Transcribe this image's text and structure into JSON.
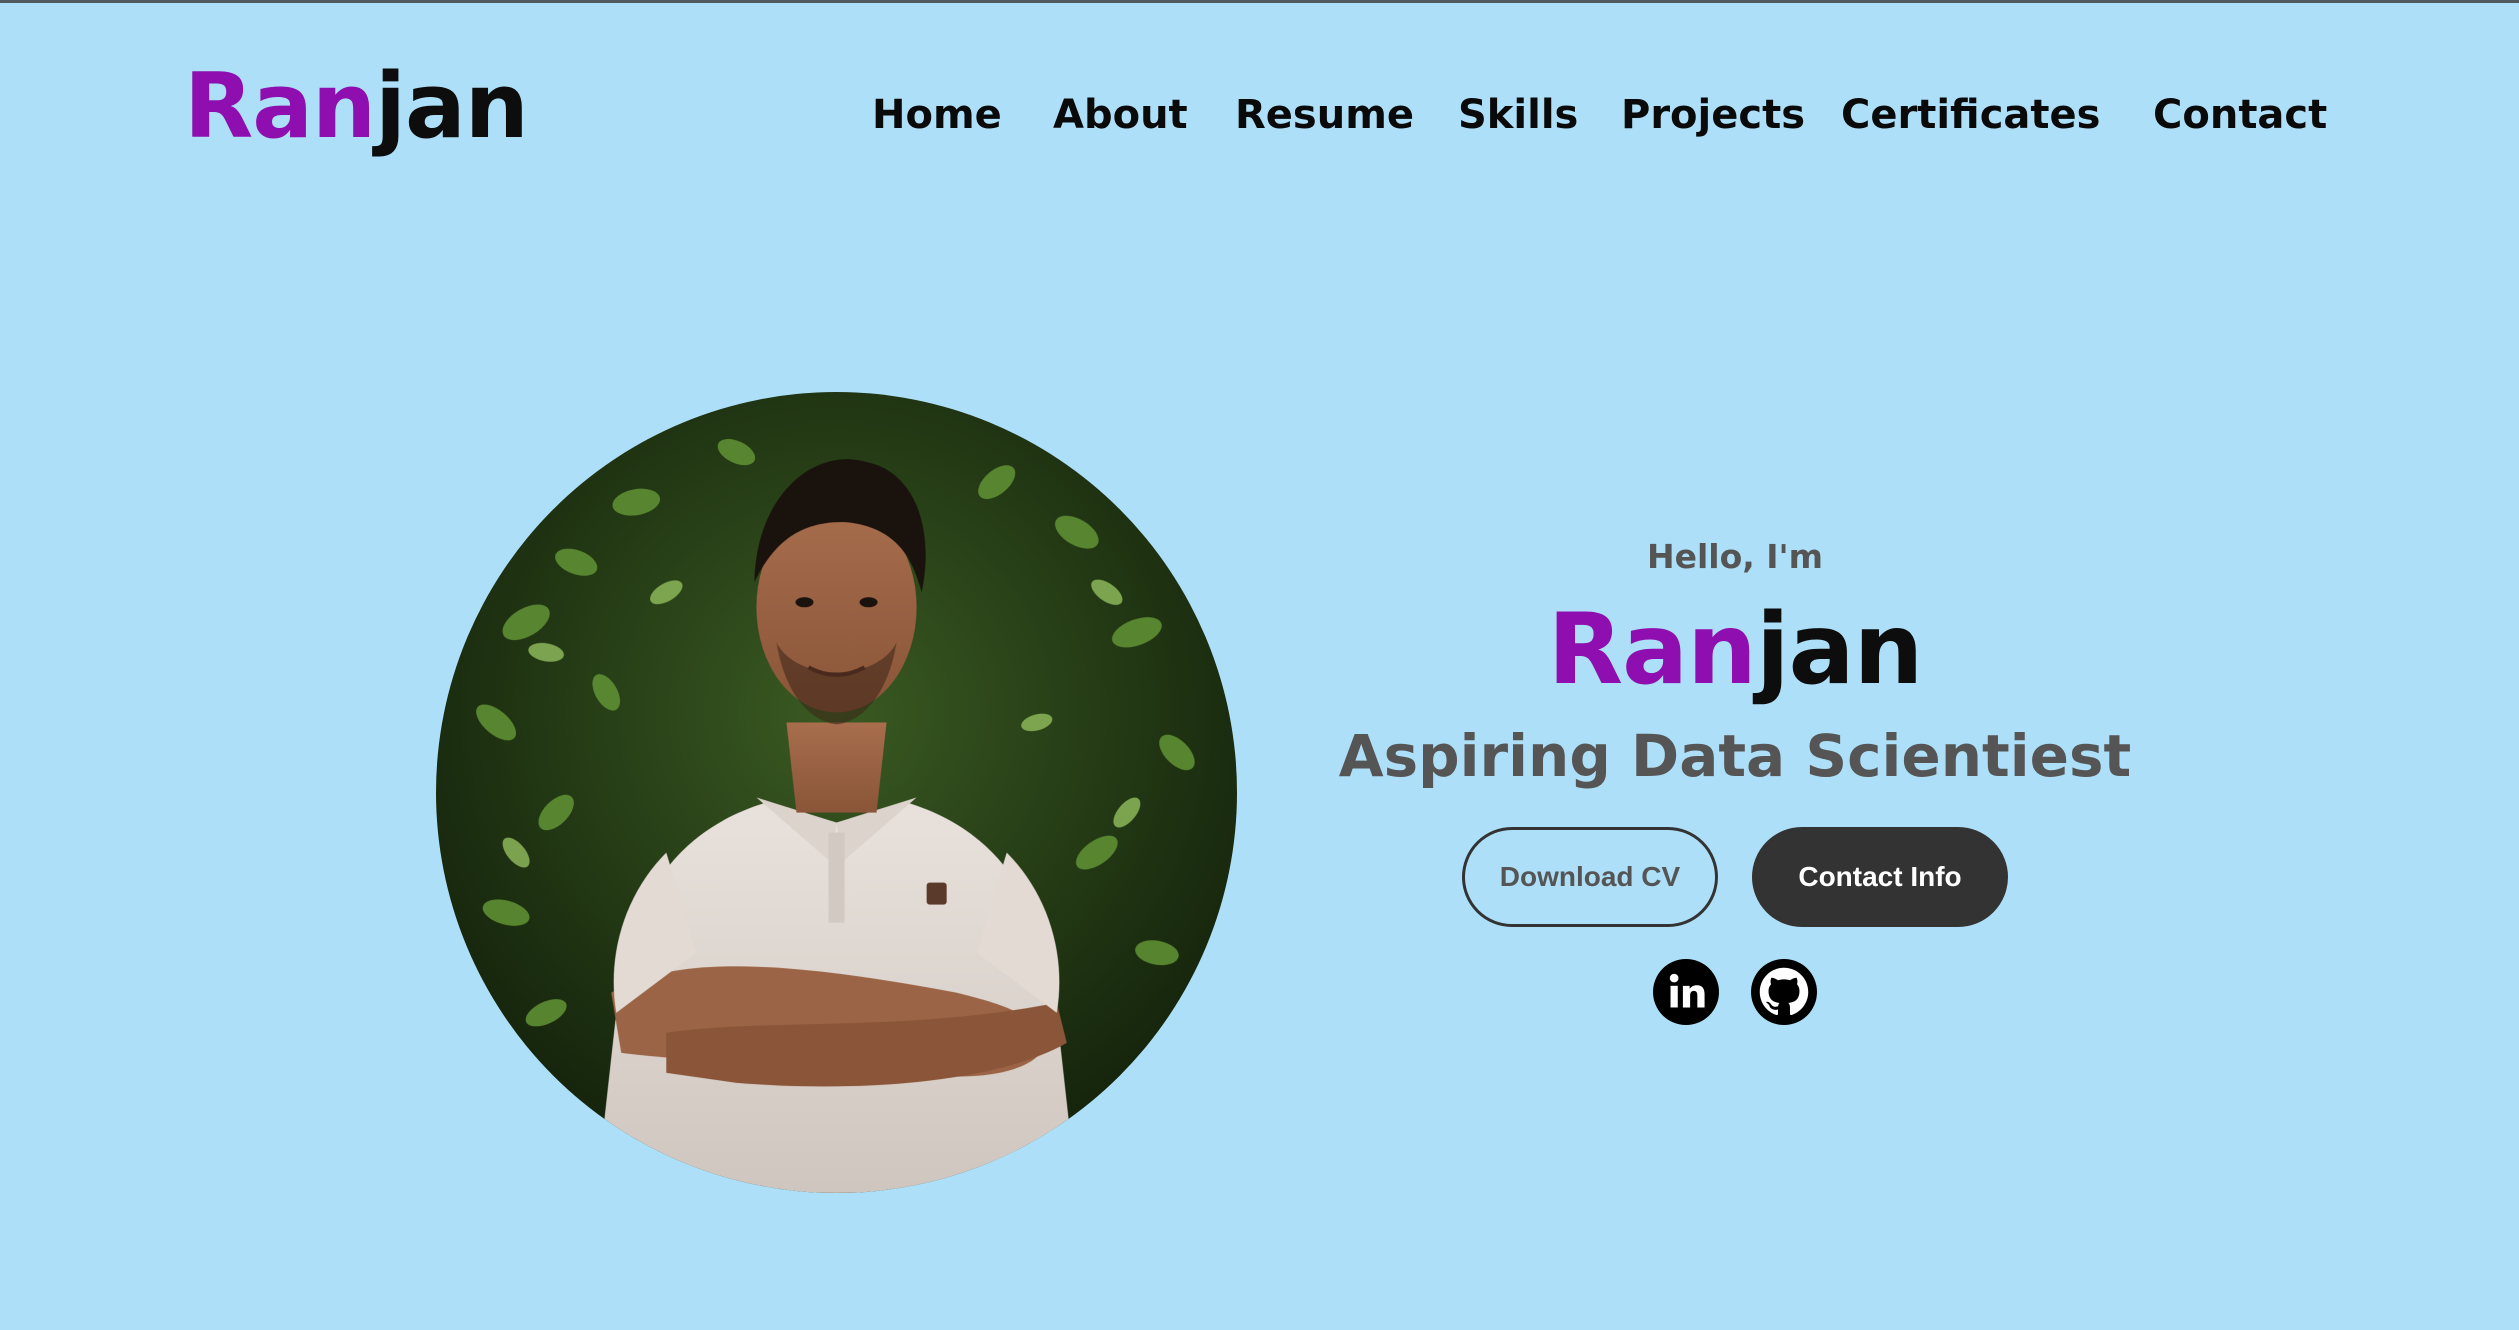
{
  "brand": {
    "logo_accent": "Ran",
    "logo_rest": "jan",
    "accent_color": "#8F0EB0"
  },
  "nav": {
    "items": [
      "Home",
      "About",
      "Resume",
      "Skills",
      "Projects",
      "Certificates",
      "Contact"
    ]
  },
  "hero": {
    "greeting": "Hello, I'm",
    "name_accent": "Ran",
    "name_rest": "jan",
    "subtitle": "Aspiring Data Scientiest",
    "primary_button": "Download CV",
    "secondary_button": "Contact Info",
    "social_icons": [
      "linkedin-icon",
      "github-icon"
    ],
    "portrait": "profile-photo"
  },
  "colors": {
    "background": "#ADE0F8",
    "button_dark": "#333333"
  }
}
